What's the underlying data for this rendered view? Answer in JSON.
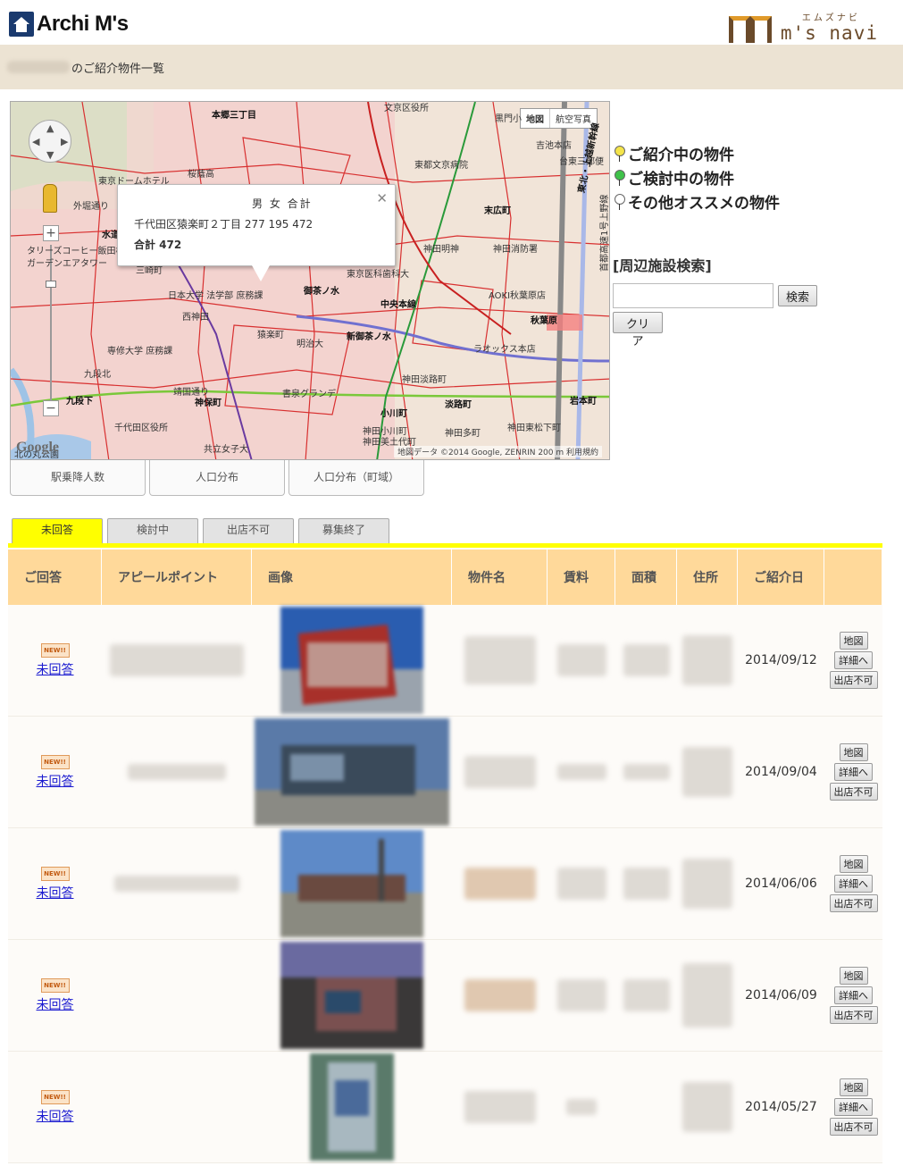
{
  "header": {
    "logo_left": "Archi M's",
    "logo_right_kana": "エムズナビ",
    "logo_right": "m's navi"
  },
  "band": {
    "title": "のご紹介物件一覧"
  },
  "map": {
    "type_buttons": [
      "地図",
      "航空写真"
    ],
    "info_window": {
      "header": "男 女 合計",
      "line": "千代田区猿楽町２丁目 277 195 472",
      "total": "合計 472"
    },
    "labels": [
      {
        "text": "本郷三丁目",
        "bold": true
      },
      {
        "text": "文京区役所"
      },
      {
        "text": "黒門小"
      },
      {
        "text": "吉池本店"
      },
      {
        "text": "台東三郵便"
      },
      {
        "text": "東京ドームホテル"
      },
      {
        "text": "桜蔭高"
      },
      {
        "text": "東都文京病院"
      },
      {
        "text": "末広町",
        "bold": true
      },
      {
        "text": "外堀通り"
      },
      {
        "text": "水道",
        "bold": true
      },
      {
        "text": "神田明神"
      },
      {
        "text": "神田消防署"
      },
      {
        "text": "タリーズコーヒー飯田橋"
      },
      {
        "text": "ガーデンエアタワー"
      },
      {
        "text": "三崎町"
      },
      {
        "text": "東京医科歯科大"
      },
      {
        "text": "御茶ノ水",
        "bold": true
      },
      {
        "text": "中央本線",
        "bold": true
      },
      {
        "text": "AOKI秋葉原店"
      },
      {
        "text": "秋葉原",
        "bold": true
      },
      {
        "text": "日本大学 法学部 庶務課"
      },
      {
        "text": "西神田"
      },
      {
        "text": "猿楽町"
      },
      {
        "text": "明治大"
      },
      {
        "text": "新御茶ノ水",
        "bold": true
      },
      {
        "text": "専修大学 庶務課"
      },
      {
        "text": "ラオックス本店"
      },
      {
        "text": "九段北"
      },
      {
        "text": "神田淡路町"
      },
      {
        "text": "九段下",
        "bold": true
      },
      {
        "text": "靖国通り"
      },
      {
        "text": "神保町",
        "bold": true
      },
      {
        "text": "書泉グランデ"
      },
      {
        "text": "小川町",
        "bold": true
      },
      {
        "text": "淡路町",
        "bold": true
      },
      {
        "text": "岩本町",
        "bold": true
      },
      {
        "text": "千代田区役所"
      },
      {
        "text": "神田小川町"
      },
      {
        "text": "神田美土代町"
      },
      {
        "text": "神田多町"
      },
      {
        "text": "神田東松下町"
      },
      {
        "text": "共立女子大"
      },
      {
        "text": "北の丸公園"
      },
      {
        "text": "東北・上越新幹線",
        "bold": true
      },
      {
        "text": "首都高速1号上野線"
      }
    ],
    "copyright": "地図データ ©2014 Google, ZENRIN   200 m   利用規約",
    "google": "Google"
  },
  "legend": [
    {
      "label": "ご紹介中の物件",
      "color": "#f4e44a"
    },
    {
      "label": "ご検討中の物件",
      "color": "#3fc24a"
    },
    {
      "label": "その他オススメの物件",
      "color": "#ffffff"
    }
  ],
  "facility": {
    "title": "[周辺施設検索]",
    "search_label": "検索",
    "clear_label": "クリア",
    "input_value": ""
  },
  "map_buttons": [
    "駅乗降人数",
    "人口分布",
    "人口分布（町域）"
  ],
  "tabs": [
    {
      "label": "未回答",
      "active": true
    },
    {
      "label": "検討中",
      "active": false
    },
    {
      "label": "出店不可",
      "active": false
    },
    {
      "label": "募集終了",
      "active": false
    }
  ],
  "table": {
    "headers": [
      "ご回答",
      "アピールポイント",
      "画像",
      "物件名",
      "賃料",
      "面積",
      "住所",
      "ご紹介日",
      ""
    ],
    "new_badge": "NEW!!",
    "actions": [
      "地図",
      "詳細へ",
      "出店不可"
    ],
    "rows": [
      {
        "status": "未回答",
        "date": "2014/09/12"
      },
      {
        "status": "未回答",
        "date": "2014/09/04"
      },
      {
        "status": "未回答",
        "date": "2014/06/06"
      },
      {
        "status": "未回答",
        "date": "2014/06/09"
      },
      {
        "status": "未回答",
        "date": "2014/05/27"
      }
    ]
  }
}
